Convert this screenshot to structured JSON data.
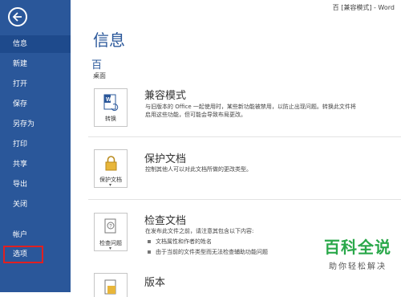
{
  "window": {
    "title": "百 [兼容模式] - Word"
  },
  "sidebar": {
    "items": [
      {
        "label": "信息"
      },
      {
        "label": "新建"
      },
      {
        "label": "打开"
      },
      {
        "label": "保存"
      },
      {
        "label": "另存为"
      },
      {
        "label": "打印"
      },
      {
        "label": "共享"
      },
      {
        "label": "导出"
      },
      {
        "label": "关闭"
      },
      {
        "label": "帐户"
      },
      {
        "label": "选项"
      }
    ]
  },
  "main": {
    "title": "信息",
    "doc_name": "百",
    "doc_path": "桌面",
    "sections": [
      {
        "tile_label": "转换",
        "title": "兼容模式",
        "desc": [
          "与旧版本的 Office 一起使用时，某些新功能被禁用，以防止出现问题。转换此文件将",
          "启用这些功能，但可能会导致布局更改。"
        ]
      },
      {
        "tile_label": "保护文档",
        "title": "保护文档",
        "desc": [
          "控制其他人可以对此文档所做的更改类型。"
        ]
      },
      {
        "tile_label": "检查问题",
        "title": "检查文档",
        "desc": [
          "在发布此文件之前，请注意其包含以下内容:"
        ],
        "bullets": [
          "文档属性和作者的姓名",
          "由于当前的文件类型而无法检查辅助功能问题"
        ]
      },
      {
        "title": "版本"
      }
    ]
  },
  "watermark": {
    "title": "百科全说",
    "subtitle": "助你轻松解决"
  }
}
